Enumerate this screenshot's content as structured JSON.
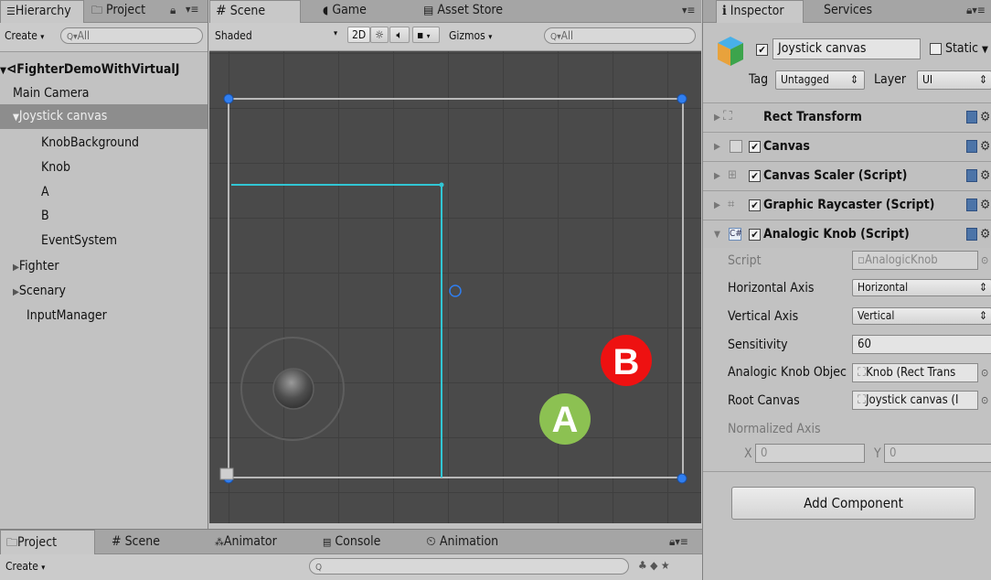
{
  "hierarchy": {
    "tab_hierarchy": "Hierarchy",
    "tab_project": "Project",
    "create_label": "Create",
    "search_placeholder": "All",
    "root": "FighterDemoWithVirtualJ",
    "items": [
      {
        "label": "Main Camera"
      },
      {
        "label": "Joystick canvas"
      },
      {
        "label": "KnobBackground"
      },
      {
        "label": "Knob"
      },
      {
        "label": "A"
      },
      {
        "label": "B"
      },
      {
        "label": "EventSystem"
      },
      {
        "label": "Fighter"
      },
      {
        "label": "Scenary"
      },
      {
        "label": "InputManager"
      }
    ]
  },
  "scene": {
    "tabs": [
      {
        "label": "Scene"
      },
      {
        "label": "Game"
      },
      {
        "label": "Asset Store"
      }
    ],
    "shading_mode": "Shaded",
    "mode_2d": "2D",
    "gizmos_label": "Gizmos",
    "search_placeholder": "All",
    "button_a": "A",
    "button_b": "B",
    "button_a_color": "#8cc152",
    "button_b_color": "#ee1111",
    "rect_color": "#31c6d4",
    "handle_color": "#2f7ef0"
  },
  "inspector": {
    "tab_inspector": "Inspector",
    "tab_services": "Services",
    "object_name": "Joystick canvas",
    "static_label": "Static",
    "tag_label": "Tag",
    "tag_value": "Untagged",
    "layer_label": "Layer",
    "layer_value": "UI",
    "components": [
      {
        "label": "Rect Transform"
      },
      {
        "label": "Canvas"
      },
      {
        "label": "Canvas Scaler (Script)"
      },
      {
        "label": "Graphic Raycaster (Script)"
      },
      {
        "label": "Analogic Knob (Script)"
      }
    ],
    "script_label": "Script",
    "script_value": "AnalogicKnob",
    "horizontal_axis_label": "Horizontal Axis",
    "horizontal_axis_value": "Horizontal",
    "vertical_axis_label": "Vertical Axis",
    "vertical_axis_value": "Vertical",
    "sensitivity_label": "Sensitivity",
    "sensitivity_value": "60",
    "knob_object_label": "Analogic Knob Objec",
    "knob_object_value": "Knob (Rect Trans",
    "root_canvas_label": "Root Canvas",
    "root_canvas_value": "Joystick canvas (I",
    "normalized_axis_label": "Normalized Axis",
    "x_label": "X",
    "x_value": "0",
    "y_label": "Y",
    "y_value": "0",
    "add_component": "Add Component"
  },
  "bottom": {
    "tabs": [
      {
        "label": "Project"
      },
      {
        "label": "Scene"
      },
      {
        "label": "Animator"
      },
      {
        "label": "Console"
      },
      {
        "label": "Animation"
      }
    ],
    "create_label": "Create"
  }
}
